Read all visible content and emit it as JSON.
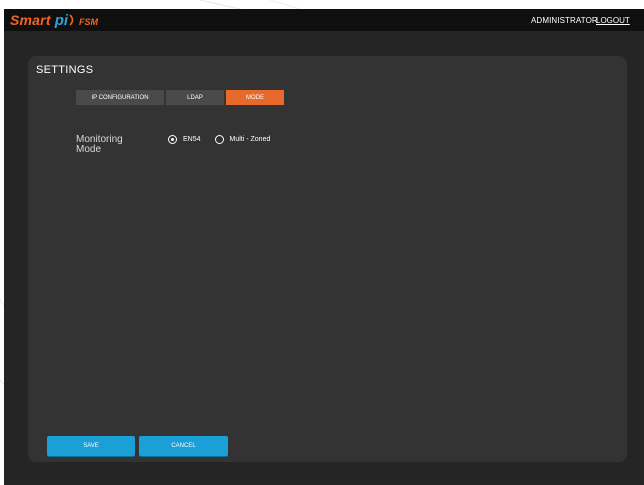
{
  "brand": {
    "smart": "Smart",
    "pi": "pi",
    "product": "FSM"
  },
  "header": {
    "user": "ADMINISTRATOR",
    "logout": "LOGOUT"
  },
  "settings": {
    "title": "SETTINGS",
    "tabs": [
      {
        "label": "IP CONFIGURATION",
        "active": false
      },
      {
        "label": "LDAP",
        "active": false
      },
      {
        "label": "MODE",
        "active": true
      }
    ],
    "monitoring_mode": {
      "label": "Monitoring Mode",
      "options": [
        {
          "label": "EN54",
          "selected": true
        },
        {
          "label": "Multi - Zoned",
          "selected": false
        }
      ]
    }
  },
  "actions": {
    "save": "SAVE",
    "cancel": "CANCEL"
  },
  "colors": {
    "accent_orange": "#e8692c",
    "button_blue": "#1a9fd6",
    "panel": "#333333",
    "background": "#252525"
  }
}
